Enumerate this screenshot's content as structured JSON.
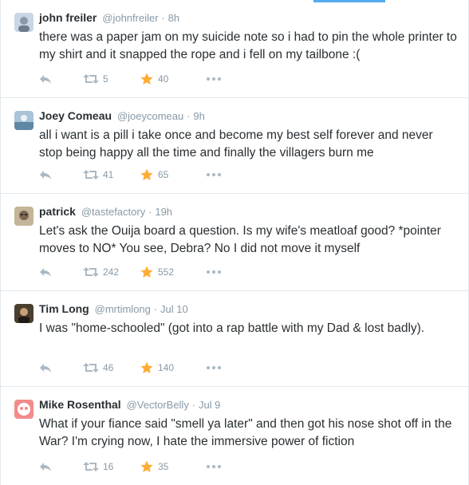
{
  "tweets": [
    {
      "name": "john freiler",
      "handle": "@johnfreiler",
      "time": "8h",
      "text": "there was a paper jam on my suicide note so i had to pin the whole printer to my shirt and it snapped the rope and i fell on my tailbone :(",
      "retweets": "5",
      "favorites": "40",
      "avatar_color": "#b7c6d6"
    },
    {
      "name": "Joey Comeau",
      "handle": "@joeycomeau",
      "time": "9h",
      "text": "all i want is a pill i take once and become my best self forever and never stop being happy all the time and finally the villagers burn me",
      "retweets": "41",
      "favorites": "65",
      "avatar_color": "#7aa1be"
    },
    {
      "name": "patrick",
      "handle": "@tastefactory",
      "time": "19h",
      "text": "Let's ask the Ouija board a question. Is my wife's meatloaf good? *pointer moves to NO* You see, Debra? No I did not move it myself",
      "retweets": "242",
      "favorites": "552",
      "avatar_color": "#8a7560"
    },
    {
      "name": "Tim Long",
      "handle": "@mrtimlong",
      "time": "Jul 10",
      "text": "I was \"home-schooled\" (got into a rap battle with my Dad & lost badly).",
      "retweets": "46",
      "favorites": "140",
      "avatar_color": "#3b3326"
    },
    {
      "name": "Mike Rosenthal",
      "handle": "@VectorBelly",
      "time": "Jul 9",
      "text": "What if your fiance said \"smell ya later\" and then got his nose shot off in the War? I'm crying now, I hate the immersive power of fiction",
      "retweets": "16",
      "favorites": "35",
      "avatar_color": "#f07f7f"
    }
  ],
  "separator": "·",
  "icons": {
    "reply": "reply-icon",
    "retweet": "retweet-icon",
    "favorite": "star-icon",
    "more": "more-icon"
  },
  "colors": {
    "text": "#292f33",
    "meta": "#8899a6",
    "favorite": "#ffac33",
    "icon": "#aab8c2",
    "accent": "#55acee",
    "border": "#e1e8ed"
  }
}
